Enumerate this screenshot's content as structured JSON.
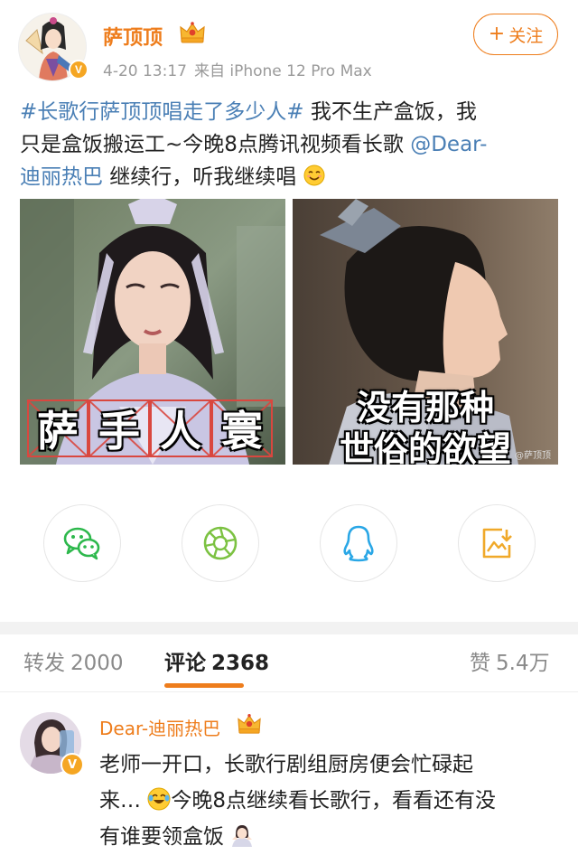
{
  "post": {
    "author": {
      "name": "萨顶顶",
      "badge": "V"
    },
    "meta": {
      "time": "4-20 13:17",
      "source": "来自 iPhone 12 Pro Max"
    },
    "follow_label": "关注",
    "text": {
      "line1_hashtag": "#长歌行萨顶顶唱走了多少人#",
      "line1_rest": " 我不生产盒饭，我",
      "line2_a": "只是盒饭搬运工~今晚8点腾讯视频看长歌 ",
      "line2_mention": "@Dear-",
      "line3_mention": "迪丽热巴",
      "line3_rest": " 继续行，听我继续唱"
    },
    "images": {
      "left_caption": [
        "萨",
        "手",
        "人",
        "寰"
      ],
      "right_caption_line1": "没有那种",
      "right_caption_line2": "世俗的欲望",
      "right_watermark": "@萨顶顶"
    }
  },
  "share": [
    {
      "icon": "wechat-icon"
    },
    {
      "icon": "moments-icon"
    },
    {
      "icon": "qq-icon"
    },
    {
      "icon": "save-image-icon"
    }
  ],
  "tabs": {
    "repost": {
      "label": "转发",
      "count": "2000"
    },
    "comment": {
      "label": "评论",
      "count": "2368"
    },
    "like": {
      "label": "赞",
      "count": "5.4万"
    }
  },
  "comment": {
    "author": "Dear-迪丽热巴",
    "badge": "V",
    "line1": "老师一开口，长歌行剧组厨房便会忙碌起",
    "line2_a": "来…",
    "line2_b": "今晚8点继续看长歌行，看看还有没",
    "line3": "有谁要领盒饭"
  },
  "colors": {
    "accent": "#ee7d1c",
    "link": "#4a7fb5",
    "badge": "#f5a623"
  }
}
